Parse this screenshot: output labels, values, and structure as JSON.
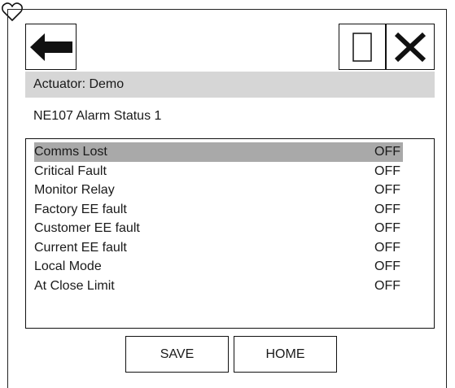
{
  "header": {
    "actuator_label": "Actuator: Demo",
    "subtitle": "NE107 Alarm Status 1"
  },
  "icons": {
    "back": "back-arrow-icon",
    "favorite": "heart-icon",
    "window": "window-icon",
    "close": "close-icon"
  },
  "alarms": [
    {
      "label": "Comms Lost",
      "value": "OFF",
      "selected": true
    },
    {
      "label": "Critical Fault",
      "value": "OFF"
    },
    {
      "label": "Monitor Relay",
      "value": "OFF"
    },
    {
      "label": "Factory EE fault",
      "value": "OFF"
    },
    {
      "label": "Customer EE fault",
      "value": "OFF"
    },
    {
      "label": "Current EE fault",
      "value": "OFF"
    },
    {
      "label": "Local Mode",
      "value": "OFF"
    },
    {
      "label": "At Close Limit",
      "value": "OFF"
    }
  ],
  "buttons": {
    "save_label": "SAVE",
    "home_label": "HOME"
  },
  "colors": {
    "header_bg": "#d6d6d6",
    "selected_row_bg": "#a9a9a9",
    "border": "#111111"
  }
}
